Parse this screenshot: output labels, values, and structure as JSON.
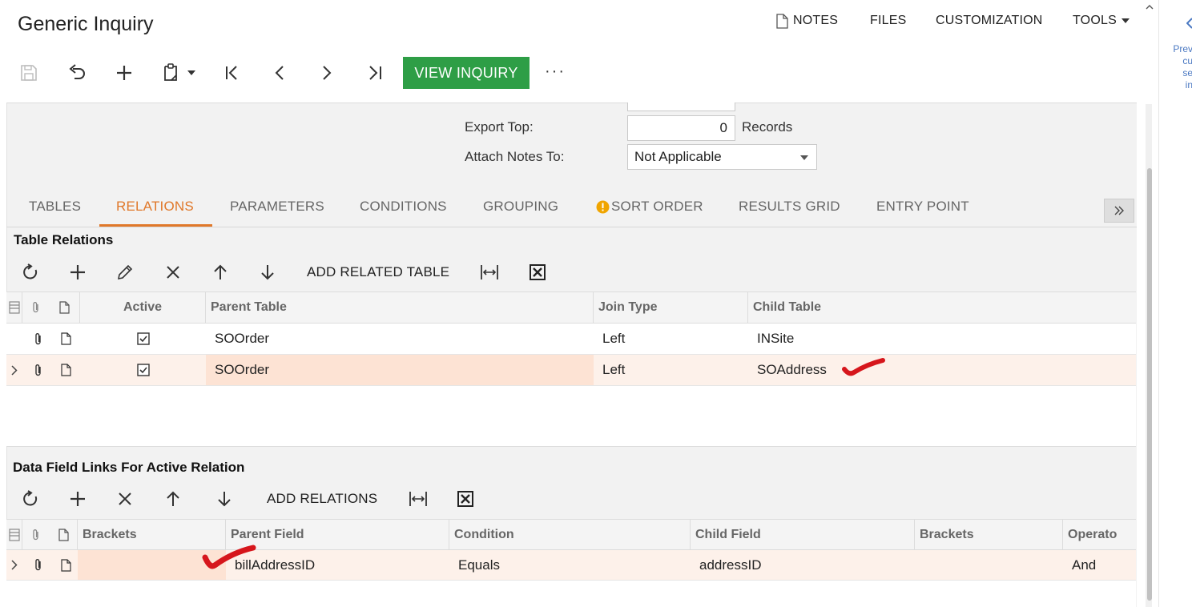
{
  "header": {
    "title": "Generic Inquiry",
    "menu": {
      "notes": "NOTES",
      "files": "FILES",
      "customization": "CUSTOMIZATION",
      "tools": "TOOLS"
    }
  },
  "toolbar": {
    "view_inquiry": "VIEW INQUIRY",
    "more": "···"
  },
  "form": {
    "export_top_label": "Export Top:",
    "export_top_value": "0",
    "export_top_unit": "Records",
    "attach_notes_label": "Attach Notes To:",
    "attach_notes_value": "Not Applicable"
  },
  "tabs": [
    {
      "label": "TABLES"
    },
    {
      "label": "RELATIONS"
    },
    {
      "label": "PARAMETERS"
    },
    {
      "label": "CONDITIONS"
    },
    {
      "label": "GROUPING"
    },
    {
      "label": "SORT ORDER",
      "warning": true
    },
    {
      "label": "RESULTS GRID"
    },
    {
      "label": "ENTRY POINT"
    }
  ],
  "active_tab": "RELATIONS",
  "table_relations": {
    "title": "Table Relations",
    "toolbar_text": "ADD RELATED TABLE",
    "columns": [
      "Active",
      "Parent Table",
      "Join Type",
      "Child Table"
    ],
    "rows": [
      {
        "active": true,
        "parent_table": "SOOrder",
        "join_type": "Left",
        "child_table": "INSite",
        "selected": false
      },
      {
        "active": true,
        "parent_table": "SOOrder",
        "join_type": "Left",
        "child_table": "SOAddress",
        "selected": true
      }
    ]
  },
  "data_field_links": {
    "title": "Data Field Links For Active Relation",
    "toolbar_text": "ADD RELATIONS",
    "columns": [
      "Brackets",
      "Parent Field",
      "Condition",
      "Child Field",
      "Brackets",
      "Operato"
    ],
    "rows": [
      {
        "brackets_open": "",
        "parent_field": "billAddressID",
        "condition": "Equals",
        "child_field": "addressID",
        "brackets_close": "",
        "operator": "And"
      }
    ]
  },
  "right_sidebar": {
    "lines": [
      "Prev",
      "cu",
      "se",
      "in"
    ]
  },
  "colors": {
    "accent": "#e0782a",
    "primary_button": "#2e9e46",
    "selected_row": "#fdf1ea",
    "highlight_cell": "#fde3d4",
    "annotation": "#d6161c"
  }
}
